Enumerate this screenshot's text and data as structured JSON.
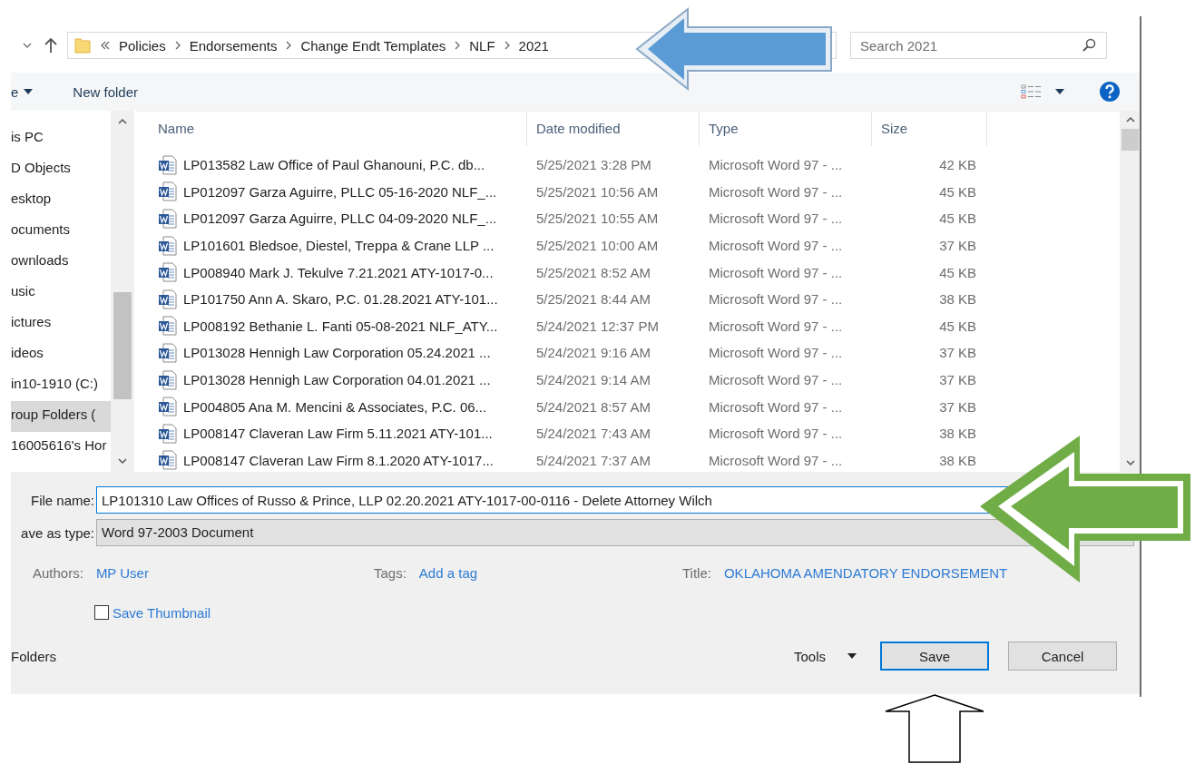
{
  "address": {
    "crumbs": [
      "Policies",
      "Endorsements",
      "Change Endt Templates",
      "NLF",
      "2021"
    ]
  },
  "search": {
    "placeholder": "Search 2021"
  },
  "toolbar": {
    "organize": "e",
    "new_folder": "New folder"
  },
  "sidebar": {
    "items": [
      {
        "label": "is PC",
        "selected": false
      },
      {
        "label": "D Objects",
        "selected": false
      },
      {
        "label": "esktop",
        "selected": false
      },
      {
        "label": "ocuments",
        "selected": false
      },
      {
        "label": "ownloads",
        "selected": false
      },
      {
        "label": "usic",
        "selected": false
      },
      {
        "label": "ictures",
        "selected": false
      },
      {
        "label": "ideos",
        "selected": false
      },
      {
        "label": "in10-1910 (C:)",
        "selected": false
      },
      {
        "label": "roup Folders (",
        "selected": true
      },
      {
        "label": "16005616's Hor",
        "selected": false
      }
    ]
  },
  "table": {
    "columns": [
      "Name",
      "Date modified",
      "Type",
      "Size"
    ],
    "rows": [
      {
        "name": "LP013582 Law Office of Paul Ghanouni, P.C. db...",
        "date": "5/25/2021 3:28 PM",
        "type": "Microsoft Word 97 - ...",
        "size": "42 KB"
      },
      {
        "name": "LP012097 Garza Aguirre, PLLC 05-16-2020 NLF_...",
        "date": "5/25/2021 10:56 AM",
        "type": "Microsoft Word 97 - ...",
        "size": "45 KB"
      },
      {
        "name": "LP012097 Garza Aguirre, PLLC 04-09-2020 NLF_...",
        "date": "5/25/2021 10:55 AM",
        "type": "Microsoft Word 97 - ...",
        "size": "45 KB"
      },
      {
        "name": "LP101601 Bledsoe, Diestel, Treppa & Crane LLP ...",
        "date": "5/25/2021 10:00 AM",
        "type": "Microsoft Word 97 - ...",
        "size": "37 KB"
      },
      {
        "name": "LP008940 Mark J. Tekulve 7.21.2021 ATY-1017-0...",
        "date": "5/25/2021 8:52 AM",
        "type": "Microsoft Word 97 - ...",
        "size": "45 KB"
      },
      {
        "name": "LP101750 Ann A. Skaro, P.C. 01.28.2021 ATY-101...",
        "date": "5/25/2021 8:44 AM",
        "type": "Microsoft Word 97 - ...",
        "size": "38 KB"
      },
      {
        "name": "LP008192 Bethanie L. Fanti 05-08-2021 NLF_ATY...",
        "date": "5/24/2021 12:37 PM",
        "type": "Microsoft Word 97 - ...",
        "size": "45 KB"
      },
      {
        "name": "LP013028 Hennigh Law Corporation 05.24.2021 ...",
        "date": "5/24/2021 9:16 AM",
        "type": "Microsoft Word 97 - ...",
        "size": "37 KB"
      },
      {
        "name": "LP013028 Hennigh Law Corporation 04.01.2021 ...",
        "date": "5/24/2021 9:14 AM",
        "type": "Microsoft Word 97 - ...",
        "size": "37 KB"
      },
      {
        "name": "LP004805 Ana M. Mencini & Associates, P.C. 06...",
        "date": "5/24/2021 8:57 AM",
        "type": "Microsoft Word 97 - ...",
        "size": "37 KB"
      },
      {
        "name": "LP008147 Claveran Law Firm 5.11.2021 ATY-101...",
        "date": "5/24/2021 7:43 AM",
        "type": "Microsoft Word 97 - ...",
        "size": "38 KB"
      },
      {
        "name": "LP008147 Claveran Law Firm 8.1.2020 ATY-1017...",
        "date": "5/24/2021 7:37 AM",
        "type": "Microsoft Word 97 - ...",
        "size": "38 KB"
      }
    ]
  },
  "file_name": {
    "label": "File name:",
    "value": "LP101310 Law Offices of Russo & Prince, LLP 02.20.2021 ATY-1017-00-0116 - Delete Attorney Wilch"
  },
  "save_as_type": {
    "label": "ave as type:",
    "value": "Word 97-2003 Document"
  },
  "metadata": [
    {
      "label": "Authors:",
      "value": "MP User"
    },
    {
      "label": "Tags:",
      "value": "Add a tag"
    },
    {
      "label": "Title:",
      "value": "OKLAHOMA AMENDATORY ENDORSEMENT"
    }
  ],
  "save_thumbnail": {
    "label": "Save Thumbnail",
    "checked": false
  },
  "folders": "Folders",
  "tools": "Tools",
  "buttons": [
    {
      "label": "Save",
      "default": true
    },
    {
      "label": "Cancel",
      "default": false
    }
  ],
  "annotations": [
    {
      "kind": "shadowed",
      "color": "#5b9bd5"
    },
    {
      "kind": "double",
      "color": "#70ad47"
    },
    {
      "kind": "outline"
    }
  ]
}
